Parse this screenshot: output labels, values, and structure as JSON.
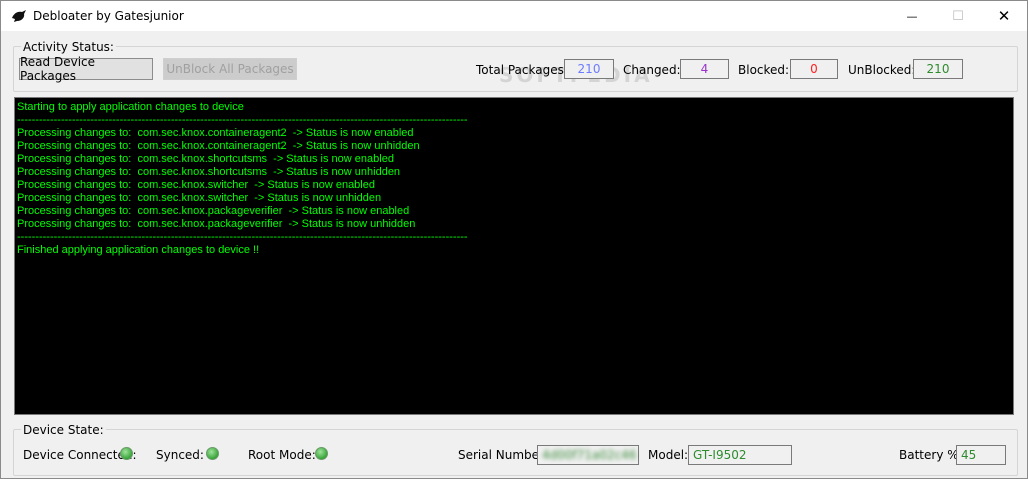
{
  "window": {
    "title": "Debloater by Gatesjunior",
    "minimize_glyph": "—",
    "maximize_glyph": "☐",
    "close_glyph": "✕"
  },
  "activity": {
    "group_label": "Activity Status:",
    "read_button": "Read Device Packages",
    "unblock_button": "UnBlock All Packages",
    "total_label": "Total Packages:",
    "total_value": "210",
    "changed_label": "Changed:",
    "changed_value": "4",
    "blocked_label": "Blocked:",
    "blocked_value": "0",
    "unblocked_label": "UnBlocked:",
    "unblocked_value": "210",
    "colors": {
      "total": "#6b7cff",
      "changed": "#9933cc",
      "blocked": "#ff2020",
      "unblocked": "#2e8b2e"
    }
  },
  "console": {
    "lines": [
      "Starting to apply application changes to device",
      "--------------------------------------------------------------------------------------------------------------------------------------------------------------------",
      "Processing changes to:  com.sec.knox.containeragent2  -> Status is now enabled",
      "Processing changes to:  com.sec.knox.containeragent2  -> Status is now unhidden",
      "Processing changes to:  com.sec.knox.shortcutsms  -> Status is now enabled",
      "Processing changes to:  com.sec.knox.shortcutsms  -> Status is now unhidden",
      "Processing changes to:  com.sec.knox.switcher  -> Status is now enabled",
      "Processing changes to:  com.sec.knox.switcher  -> Status is now unhidden",
      "Processing changes to:  com.sec.knox.packageverifier  -> Status is now enabled",
      "Processing changes to:  com.sec.knox.packageverifier  -> Status is now unhidden",
      "--------------------------------------------------------------------------------------------------------------------------------------------------------------------",
      "Finished applying application changes to device !!"
    ]
  },
  "device": {
    "group_label": "Device State:",
    "connected_label": "Device Connected:",
    "synced_label": "Synced:",
    "root_label": "Root Mode:",
    "serial_label": "Serial Number:",
    "serial_value": "4d00f71a02c46",
    "model_label": "Model:",
    "model_value": "GT-I9502",
    "battery_label": "Battery %:",
    "battery_value": "45",
    "status_color": "#3aa53a"
  }
}
